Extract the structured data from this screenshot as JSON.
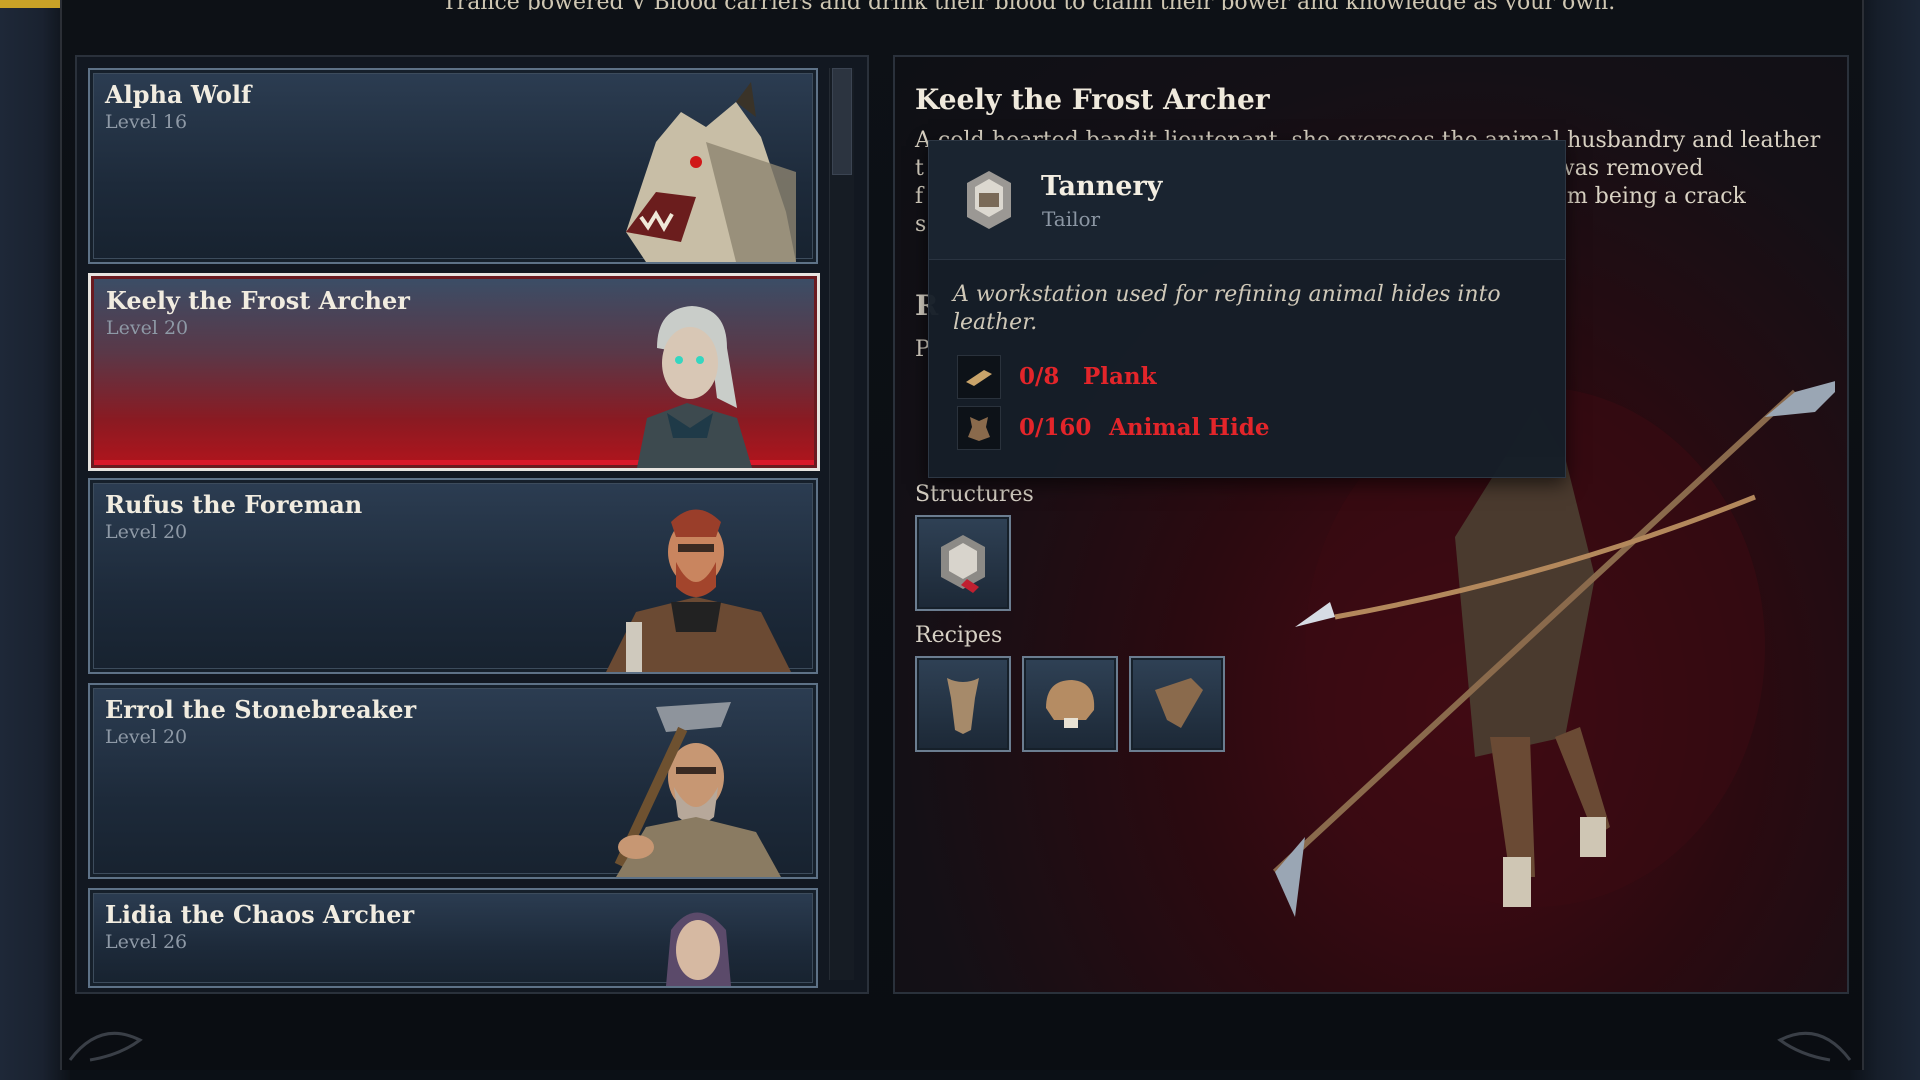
{
  "header": {
    "top_text": "Trance powered V Blood carriers and drink their blood to claim their power and knowledge as your own."
  },
  "characters": [
    {
      "name": "Alpha Wolf",
      "level": "Level 16",
      "portrait_icon": "wolf-portrait-icon"
    },
    {
      "name": "Keely the Frost Archer",
      "level": "Level 20",
      "portrait_icon": "frost-archer-portrait-icon",
      "selected": true
    },
    {
      "name": "Rufus the Foreman",
      "level": "Level 20",
      "portrait_icon": "foreman-portrait-icon"
    },
    {
      "name": "Errol the Stonebreaker",
      "level": "Level 20",
      "portrait_icon": "stonebreaker-portrait-icon"
    },
    {
      "name": "Lidia the Chaos Archer",
      "level": "Level 26",
      "portrait_icon": "chaos-archer-portrait-icon"
    }
  ],
  "detail": {
    "title": "Keely the Frost Archer",
    "description_lines": [
      "A cold-hearted bandit lieutenant, she oversees the animal husbandry and leather",
      "t                                                                                a, she was removed",
      "f                                                                                side from being a crack",
      "s"
    ],
    "hidden_label_r": "R",
    "hidden_label_p": "P",
    "structures_label": "Structures",
    "recipes_label": "Recipes",
    "structures": [
      {
        "icon": "tannery-structure-icon"
      }
    ],
    "recipes": [
      {
        "icon": "leather-scarf-icon"
      },
      {
        "icon": "leather-cap-icon"
      },
      {
        "icon": "leather-scrap-icon"
      }
    ]
  },
  "tooltip": {
    "title": "Tannery",
    "subtitle": "Tailor",
    "description": "A workstation used for refining animal hides into leather.",
    "requirements": [
      {
        "count": "0/8",
        "name": "Plank",
        "icon": "plank-icon"
      },
      {
        "count": "0/160",
        "name": "Animal Hide",
        "icon": "animal-hide-icon"
      }
    ],
    "icon": "tannery-icon"
  },
  "colors": {
    "requirement_missing": "#e3252a",
    "selected_card": "#b3141c",
    "accent_border": "#6b7d90"
  }
}
